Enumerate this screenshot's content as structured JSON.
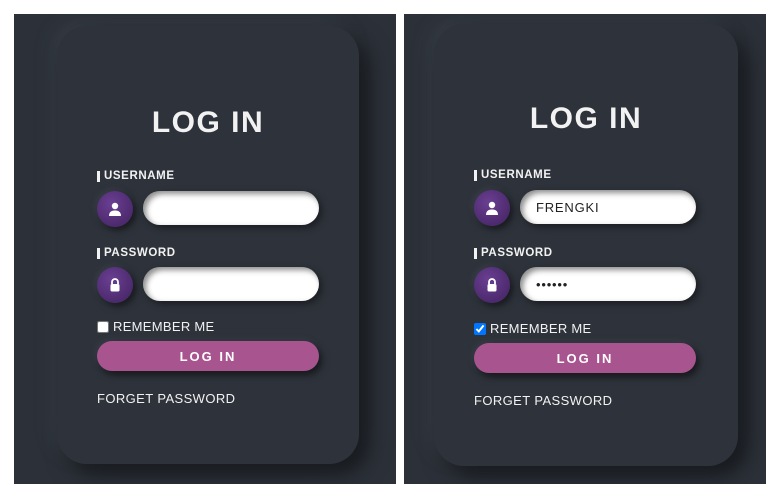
{
  "panels": [
    {
      "title": "LOG IN",
      "username_label": "USERNAME",
      "username_value": "",
      "password_label": "PASSWORD",
      "password_value": "",
      "remember_label": "REMEMBER ME",
      "remember_checked": false,
      "login_button": "LOG IN",
      "forget_password": "FORGET PASSWORD"
    },
    {
      "title": "LOG IN",
      "username_label": "USERNAME",
      "username_value": "FRENGKI",
      "password_label": "PASSWORD",
      "password_value": "••••••",
      "remember_label": "REMEMBER ME",
      "remember_checked": true,
      "login_button": "LOG IN",
      "forget_password": "FORGET PASSWORD"
    }
  ],
  "icons": {
    "username": "user-icon",
    "password": "lock-icon"
  },
  "colors": {
    "background": "#2c3139",
    "card": "#2e333b",
    "icon_circle": "#5a3380",
    "button": "#a8548f",
    "text": "#f2f2f2"
  }
}
